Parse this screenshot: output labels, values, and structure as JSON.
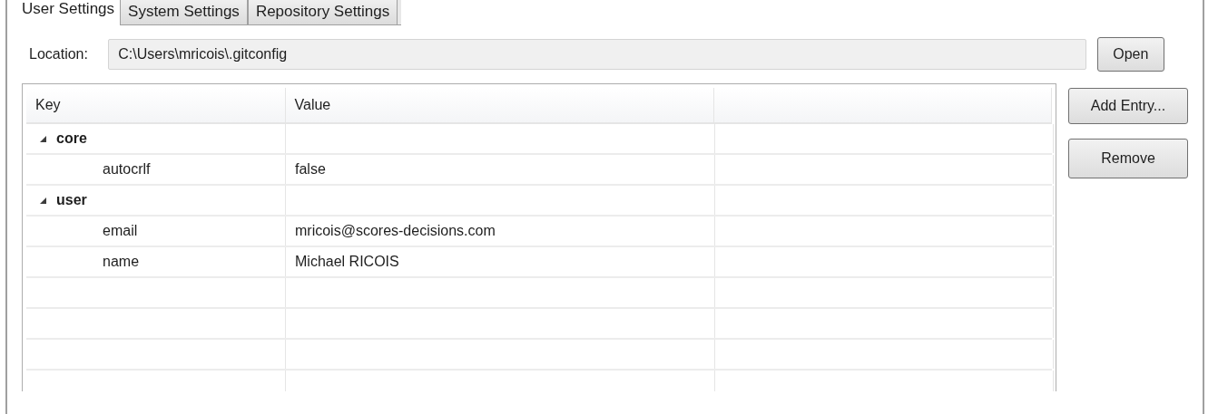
{
  "tabs": [
    {
      "label": "User Settings",
      "selected": true
    },
    {
      "label": "System Settings",
      "selected": false
    },
    {
      "label": "Repository Settings",
      "selected": false
    }
  ],
  "location": {
    "label": "Location:",
    "value": "C:\\Users\\mricois\\.gitconfig",
    "button": "Open"
  },
  "table": {
    "columns": [
      "Key",
      "Value"
    ],
    "rows": [
      {
        "key": "core",
        "expanded": true,
        "children": [
          {
            "key": "autocrlf",
            "value": "false"
          }
        ]
      },
      {
        "key": "user",
        "expanded": true,
        "children": [
          {
            "key": "email",
            "value": "mricois@scores-decisions.com"
          },
          {
            "key": "name",
            "value": "Michael RICOIS"
          }
        ]
      }
    ]
  },
  "buttons": [
    "Add Entry...",
    "Remove"
  ]
}
